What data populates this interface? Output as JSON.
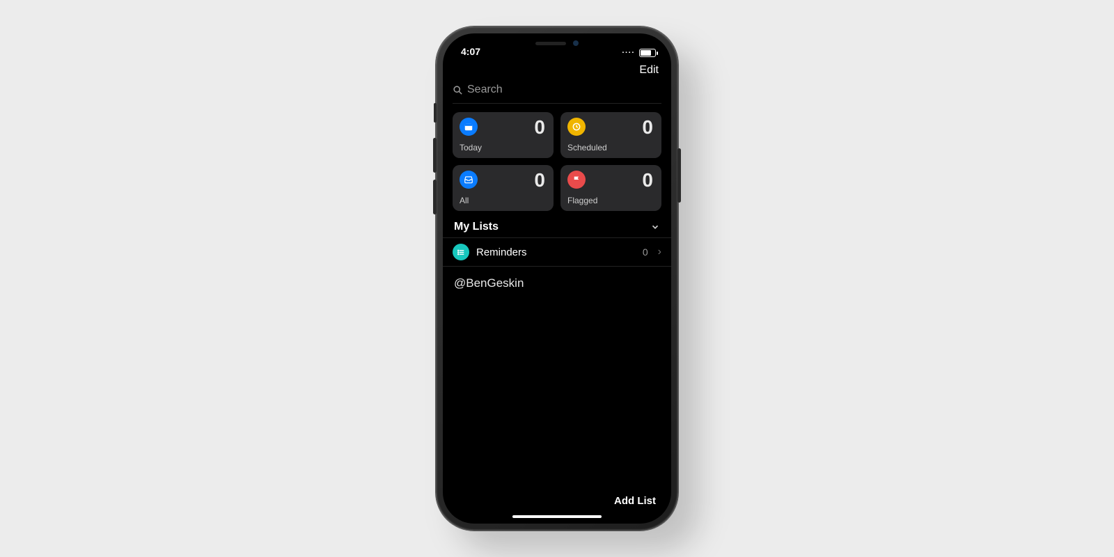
{
  "status": {
    "time": "4:07",
    "signal_dots": "····"
  },
  "nav": {
    "edit": "Edit"
  },
  "search": {
    "placeholder": "Search"
  },
  "cards": [
    {
      "id": "today",
      "label": "Today",
      "count": "0",
      "icon": "calendar-icon",
      "color": "#0a7cff"
    },
    {
      "id": "scheduled",
      "label": "Scheduled",
      "count": "0",
      "icon": "clock-icon",
      "color": "#f0b500"
    },
    {
      "id": "all",
      "label": "All",
      "count": "0",
      "icon": "tray-icon",
      "color": "#0a7cff"
    },
    {
      "id": "flagged",
      "label": "Flagged",
      "count": "0",
      "icon": "flag-icon",
      "color": "#e94b4b"
    }
  ],
  "sections": {
    "my_lists": {
      "title": "My Lists",
      "items": [
        {
          "name": "Reminders",
          "count": "0",
          "icon": "list-icon",
          "color": "#17c7bd"
        }
      ]
    }
  },
  "watermark": "@BenGeskin",
  "bottom": {
    "add_list": "Add List"
  }
}
